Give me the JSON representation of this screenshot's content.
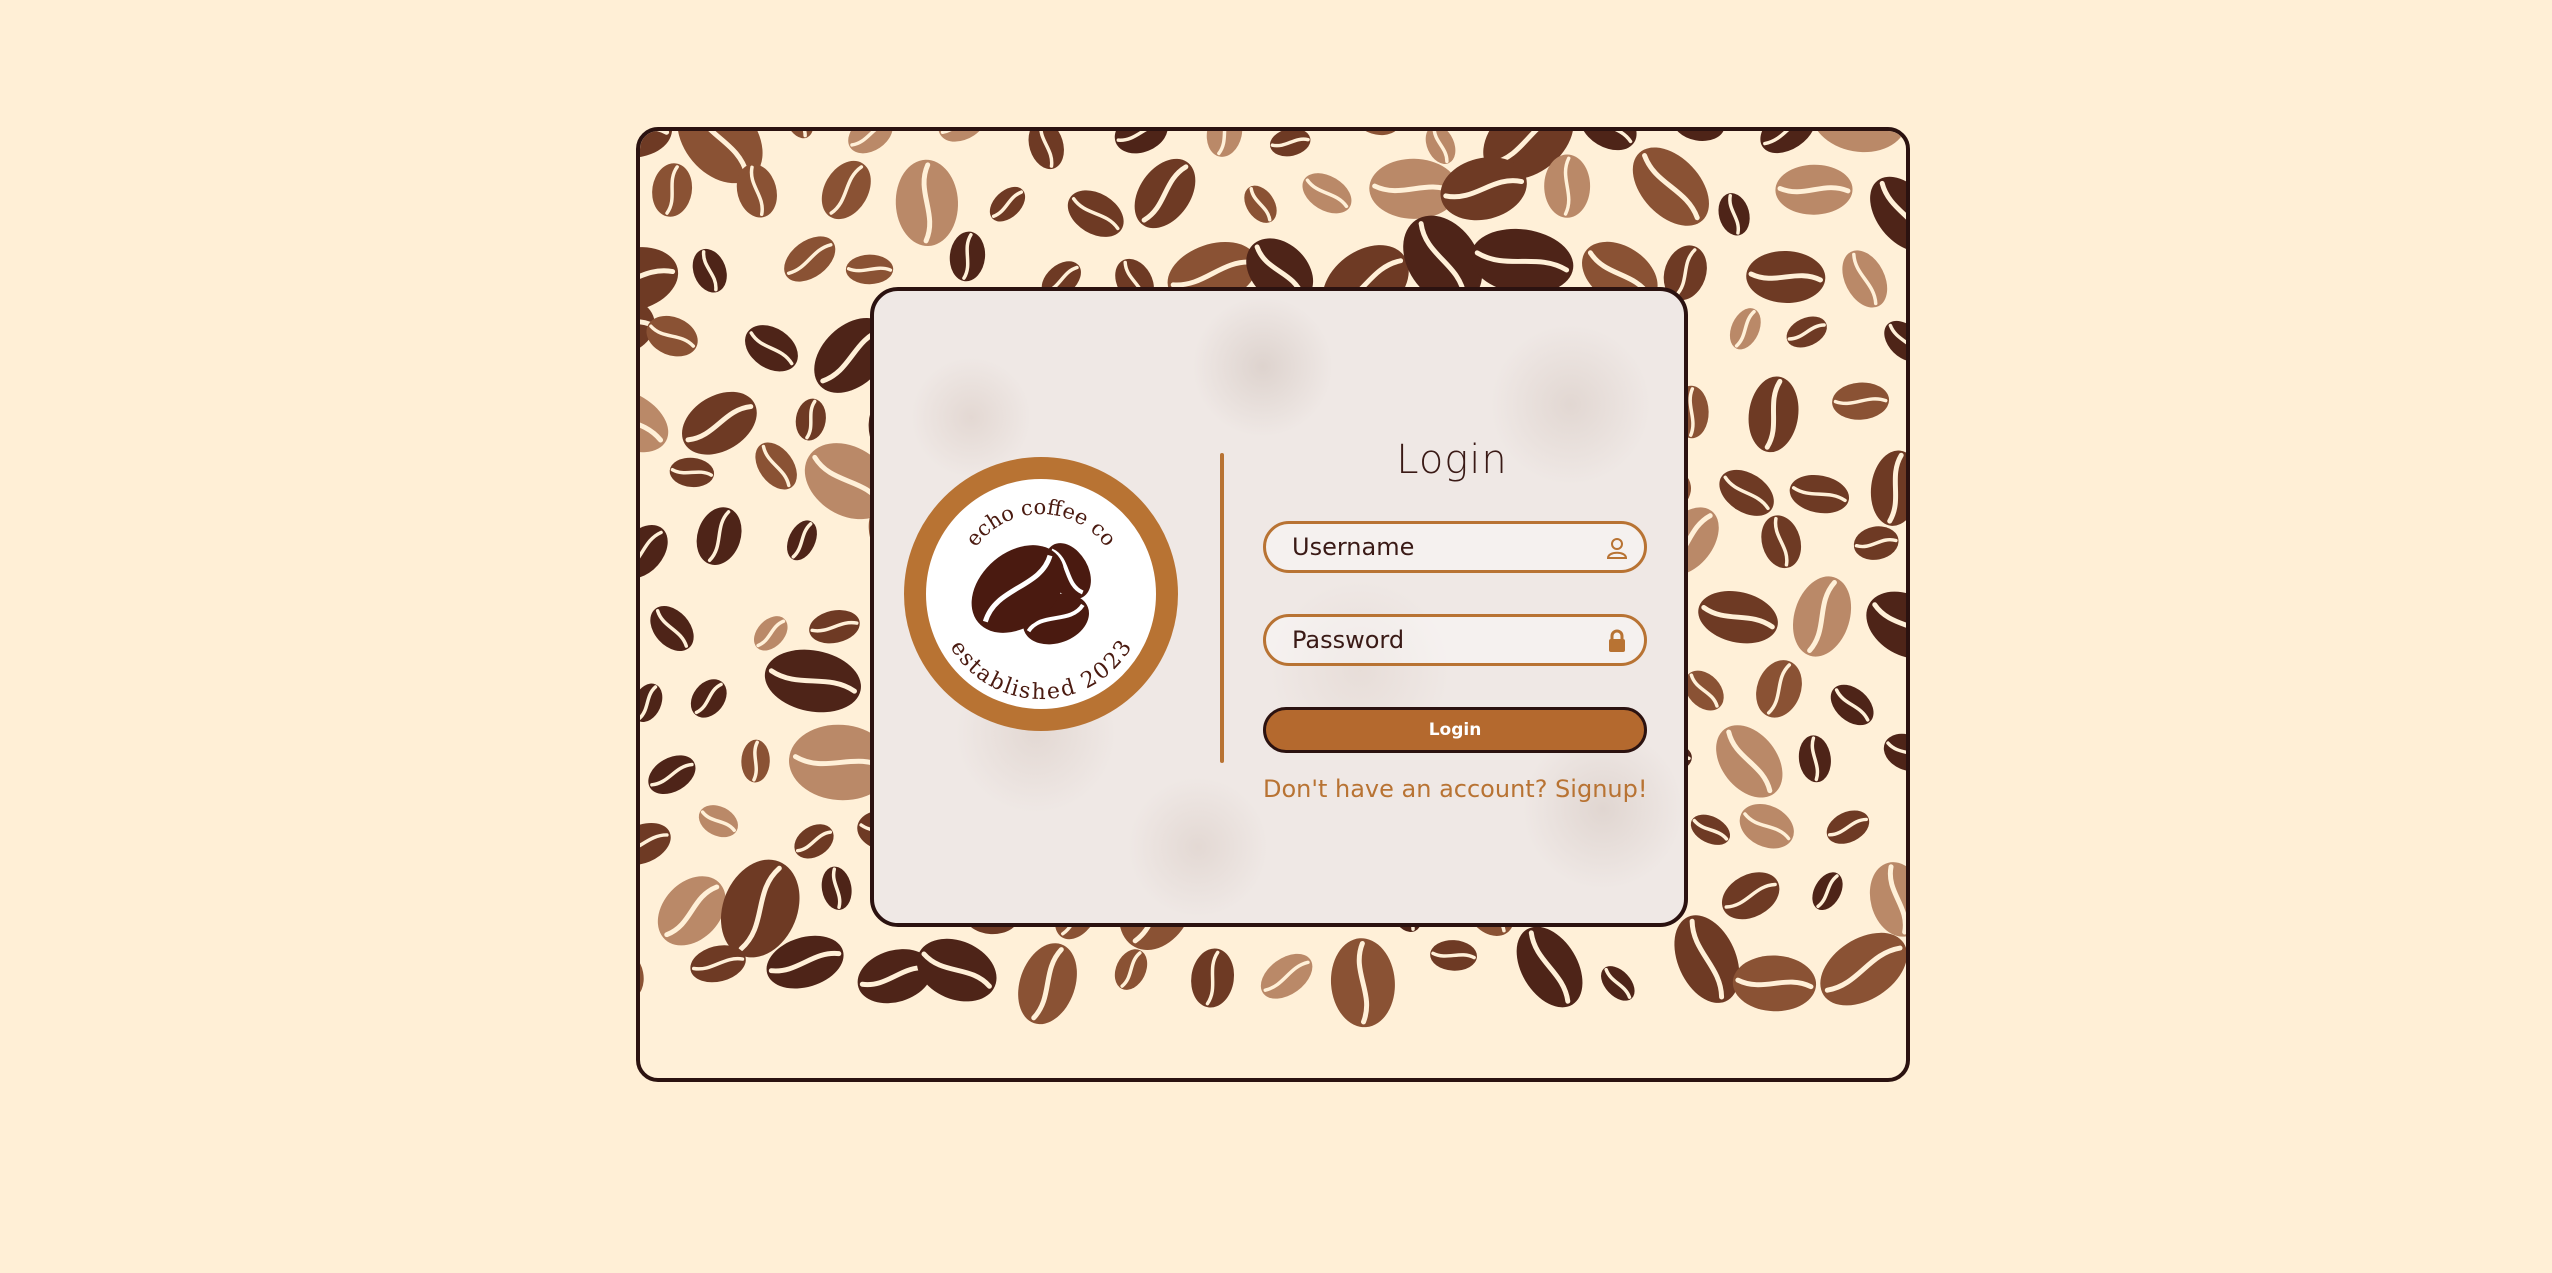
{
  "colors": {
    "page_background": "#ffefd6",
    "accent": "#b87333",
    "border": "#2b1210",
    "button": "#b4692e",
    "bean_dark": "#4e2418",
    "bean_medium": "#8a5234",
    "bean_light": "#ba8968"
  },
  "logo": {
    "top_text": "echo coffee co",
    "bottom_text": "established 2023",
    "icon": "coffee-beans-icon"
  },
  "login": {
    "title": "Login",
    "username_placeholder": "Username",
    "username_icon": "user-icon",
    "password_placeholder": "Password",
    "password_icon": "lock-icon",
    "button_label": "Login",
    "signup_text": "Don't have an account? Signup!"
  }
}
